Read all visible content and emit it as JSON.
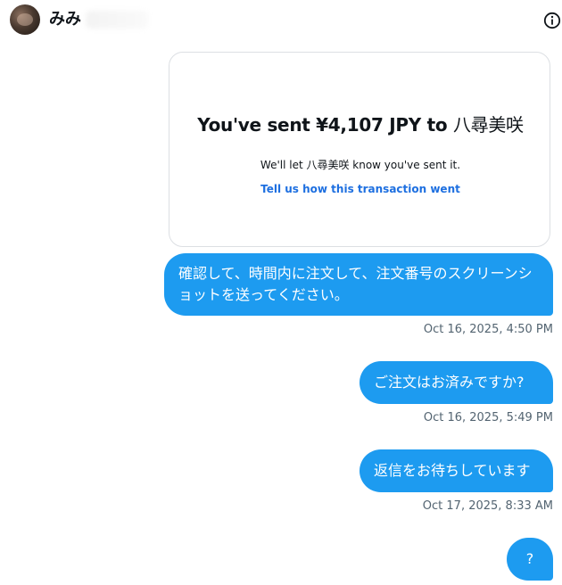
{
  "header": {
    "username": "みみ",
    "info_icon": "info-circle-icon"
  },
  "card": {
    "title_prefix": "You've sent ¥4,107 JPY to",
    "recipient": "八尋美咲",
    "subtitle": "We'll let 八尋美咲 know you've sent it.",
    "link": "Tell us how this transaction went"
  },
  "messages": [
    {
      "text": "確認して、時間内に注文して、注文番号のスクリーンショットを送ってください。",
      "timestamp": "Oct 16, 2025, 4:50 PM"
    },
    {
      "text": "ご注文はお済みですか?",
      "timestamp": "Oct 16, 2025, 5:49 PM"
    },
    {
      "text": "返信をお待ちしています",
      "timestamp": "Oct 17, 2025, 8:33 AM"
    },
    {
      "text": "?"
    }
  ],
  "colors": {
    "bubble": "#1d9bf0",
    "link": "#1d6fe0",
    "timestamp": "#536471"
  }
}
